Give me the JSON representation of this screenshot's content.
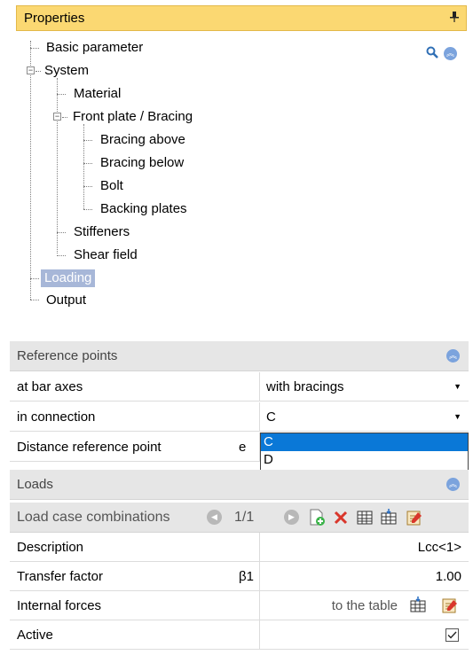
{
  "properties": {
    "title": "Properties",
    "pin_icon": "pin-icon"
  },
  "tree": {
    "basic_parameter": "Basic parameter",
    "system": "System",
    "material": "Material",
    "front_plate": "Front plate / Bracing",
    "bracing_above": "Bracing above",
    "bracing_below": "Bracing below",
    "bolt": "Bolt",
    "backing_plates": "Backing plates",
    "stiffeners": "Stiffeners",
    "shear_field": "Shear field",
    "loading": "Loading",
    "output": "Output"
  },
  "reference_points": {
    "title": "Reference points",
    "rows": [
      {
        "label": "at bar axes",
        "value": "with bracings"
      },
      {
        "label": "in connection",
        "value": "C"
      },
      {
        "label": "Distance reference point",
        "symbol": "e"
      }
    ],
    "dropdown_options": [
      "C",
      "D"
    ],
    "selected_option": "C"
  },
  "loads": {
    "title": "Loads",
    "lcc_title": "Load case combinations",
    "pager": "1/1",
    "rows": [
      {
        "label": "Description",
        "value": "Lcc<1>"
      },
      {
        "label": "Transfer factor",
        "symbol": "β1",
        "value": "1.00"
      },
      {
        "label": "Internal forces",
        "value": "to the table"
      },
      {
        "label": "Active",
        "checked": true
      }
    ]
  },
  "colors": {
    "header_bg": "#fbd872",
    "selection_bg": "#a7b7d8",
    "dropdown_highlight": "#0a78d7"
  }
}
